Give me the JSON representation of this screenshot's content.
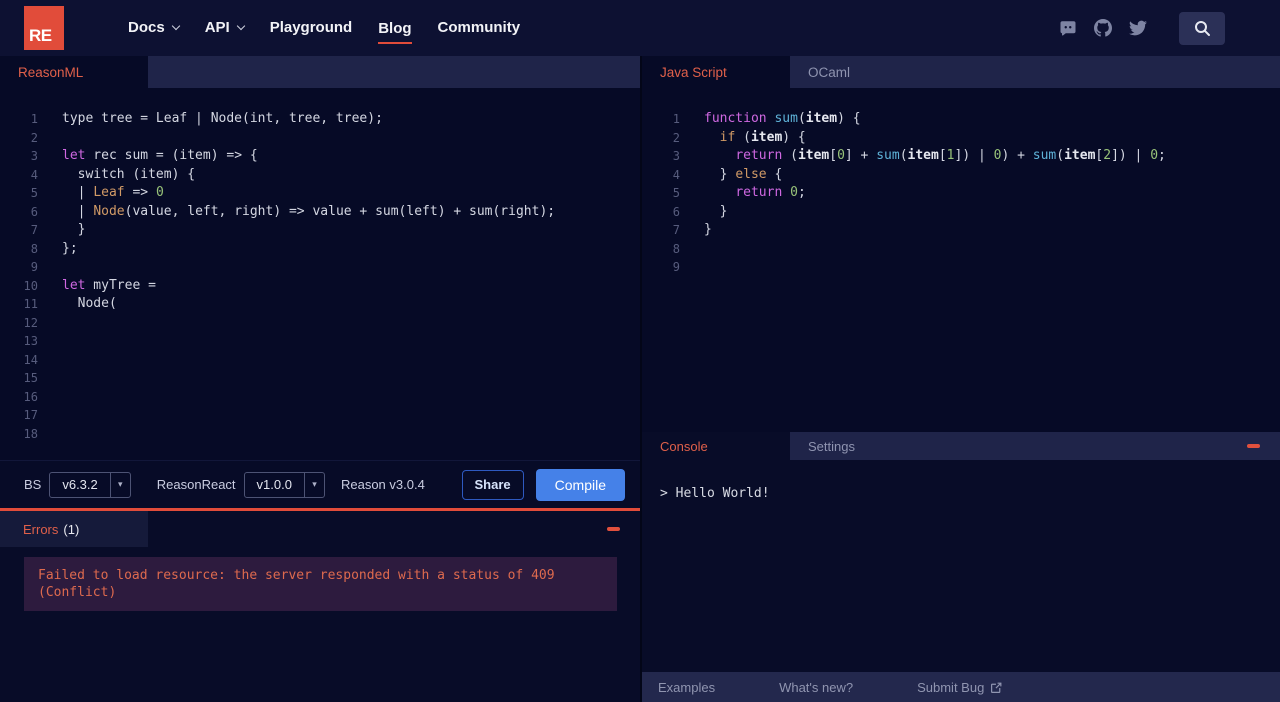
{
  "colors": {
    "brand_red": "#e14c3a",
    "active_tab_text": "#e0604a",
    "compile_blue": "#4581e8",
    "share_border_blue": "#2e59c0",
    "error_box_bg": "#2d1b3e",
    "error_text": "#de6a4e"
  },
  "header": {
    "logo_text": "RE",
    "nav_items": [
      {
        "label": "Docs",
        "dropdown": true,
        "active": false
      },
      {
        "label": "API",
        "dropdown": true,
        "active": false
      },
      {
        "label": "Playground",
        "dropdown": false,
        "active": false
      },
      {
        "label": "Blog",
        "dropdown": false,
        "active": true
      },
      {
        "label": "Community",
        "dropdown": false,
        "active": false
      }
    ]
  },
  "icons": {
    "select_arrow": "▾"
  },
  "left_editor": {
    "tab_label": "ReasonML",
    "total_lines": 18,
    "lines": [
      [
        [
          "d",
          "type tree = Leaf | Node(int, tree, tree);"
        ]
      ],
      [],
      [
        [
          "k",
          "let"
        ],
        [
          "d",
          " rec sum = (item) => {"
        ]
      ],
      [
        [
          "d",
          "  switch (item) {"
        ]
      ],
      [
        [
          "d",
          "  | "
        ],
        [
          "v",
          "Leaf"
        ],
        [
          "d",
          " => "
        ],
        [
          "n",
          "0"
        ]
      ],
      [
        [
          "d",
          "  | "
        ],
        [
          "v",
          "Node"
        ],
        [
          "d",
          "(value, left, right) => value + sum(left) + sum(right);"
        ]
      ],
      [
        [
          "d",
          "  }"
        ]
      ],
      [
        [
          "d",
          "};"
        ]
      ],
      [],
      [
        [
          "k",
          "let"
        ],
        [
          "d",
          " myTree ="
        ]
      ],
      [
        [
          "d",
          "  Node("
        ]
      ],
      [],
      [],
      [],
      [],
      [],
      [],
      []
    ]
  },
  "toolbar": {
    "bs_label": "BS",
    "bs_version": "v6.3.2",
    "reasonreact_label": "ReasonReact",
    "reasonreact_version": "v1.0.0",
    "reason_version": "Reason v3.0.4",
    "share_label": "Share",
    "compile_label": "Compile"
  },
  "errors_panel": {
    "tab_label": "Errors",
    "count": "(1)",
    "message": "Failed to load resource: the server responded with a status of 409 (Conflict)"
  },
  "right_editor": {
    "tabs": [
      {
        "label": "Java Script",
        "active": true
      },
      {
        "label": "OCaml",
        "active": false
      }
    ],
    "total_lines": 9,
    "lines": [
      [
        [
          "k",
          "function"
        ],
        [
          "d",
          " "
        ],
        [
          "f",
          "sum"
        ],
        [
          "d",
          "("
        ],
        [
          "p",
          "item"
        ],
        [
          "d",
          ") {"
        ]
      ],
      [
        [
          "d",
          "  "
        ],
        [
          "o",
          "if"
        ],
        [
          "d",
          " ("
        ],
        [
          "p",
          "item"
        ],
        [
          "d",
          ") {"
        ]
      ],
      [
        [
          "d",
          "    "
        ],
        [
          "k",
          "return"
        ],
        [
          "d",
          " ("
        ],
        [
          "p",
          "item"
        ],
        [
          "d",
          "["
        ],
        [
          "n",
          "0"
        ],
        [
          "d",
          "] + "
        ],
        [
          "f",
          "sum"
        ],
        [
          "d",
          "("
        ],
        [
          "p",
          "item"
        ],
        [
          "d",
          "["
        ],
        [
          "n",
          "1"
        ],
        [
          "d",
          "]) | "
        ],
        [
          "n",
          "0"
        ],
        [
          "d",
          ") + "
        ],
        [
          "f",
          "sum"
        ],
        [
          "d",
          "("
        ],
        [
          "p",
          "item"
        ],
        [
          "d",
          "["
        ],
        [
          "n",
          "2"
        ],
        [
          "d",
          "]) | "
        ],
        [
          "n",
          "0"
        ],
        [
          "d",
          ";"
        ]
      ],
      [
        [
          "d",
          "  } "
        ],
        [
          "o",
          "else"
        ],
        [
          "d",
          " {"
        ]
      ],
      [
        [
          "d",
          "    "
        ],
        [
          "k",
          "return"
        ],
        [
          "d",
          " "
        ],
        [
          "n",
          "0"
        ],
        [
          "d",
          ";"
        ]
      ],
      [
        [
          "d",
          "  }"
        ]
      ],
      [
        [
          "d",
          "}"
        ]
      ],
      [],
      []
    ]
  },
  "console_panel": {
    "tabs": [
      {
        "label": "Console",
        "active": true
      },
      {
        "label": "Settings",
        "active": false
      }
    ],
    "output": "> Hello World!"
  },
  "footer": {
    "links": [
      "Examples",
      "What's new?",
      "Submit Bug"
    ]
  }
}
